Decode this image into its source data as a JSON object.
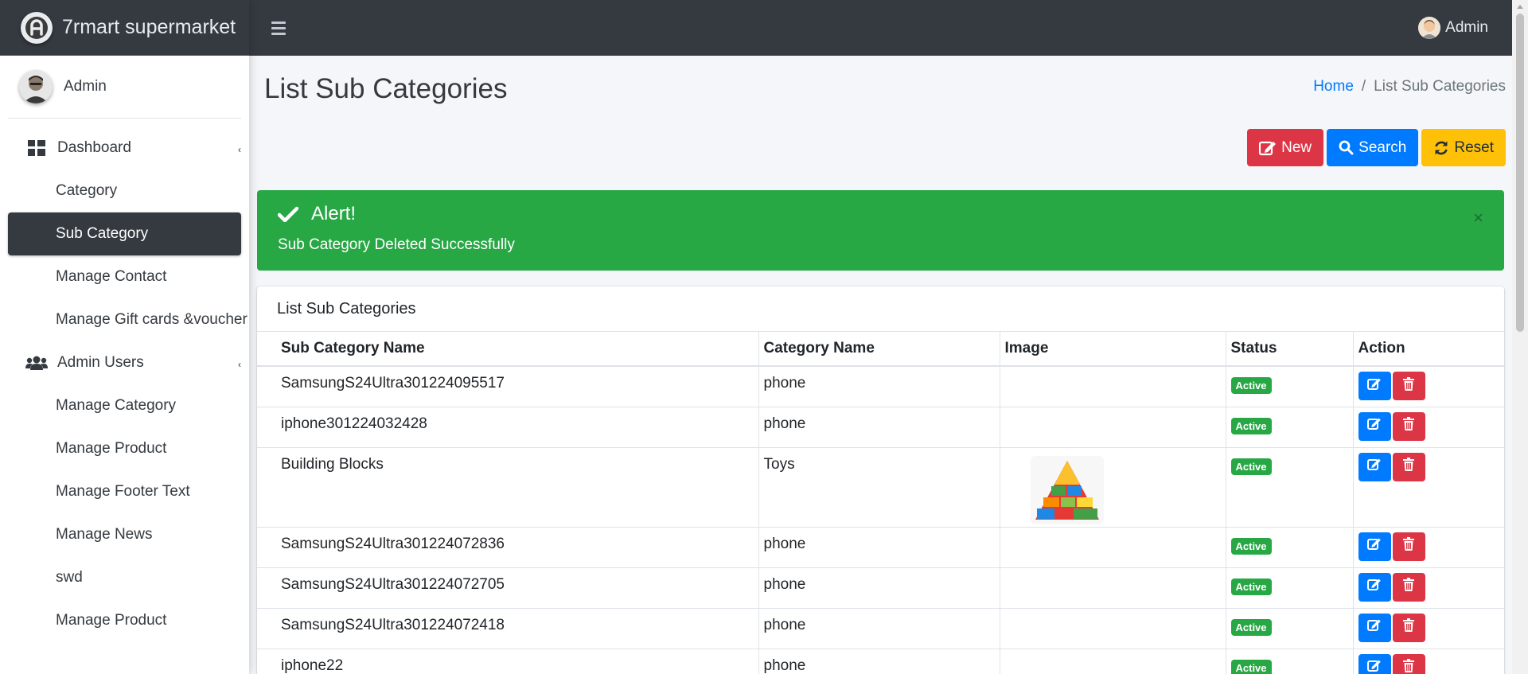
{
  "brand": {
    "name": "7rmart supermarket"
  },
  "topbar": {
    "user": "Admin"
  },
  "sidebar": {
    "user": "Admin",
    "items": [
      {
        "label": "Dashboard",
        "icon": "dashboard-icon",
        "type": "parent"
      },
      {
        "label": "Category",
        "type": "sub"
      },
      {
        "label": "Sub Category",
        "type": "sub",
        "active": true
      },
      {
        "label": "Manage Contact",
        "type": "sub"
      },
      {
        "label": "Manage Gift cards &voucher",
        "type": "sub"
      },
      {
        "label": "Admin Users",
        "icon": "users-icon",
        "type": "parent"
      },
      {
        "label": "Manage Category",
        "type": "sub"
      },
      {
        "label": "Manage Product",
        "type": "sub"
      },
      {
        "label": "Manage Footer Text",
        "type": "sub"
      },
      {
        "label": "Manage News",
        "type": "sub"
      },
      {
        "label": "swd",
        "type": "sub"
      },
      {
        "label": "Manage Product",
        "type": "sub"
      }
    ]
  },
  "page": {
    "title": "List Sub Categories",
    "breadcrumb": {
      "home": "Home",
      "separator": "/",
      "current": "List Sub Categories"
    }
  },
  "buttons": {
    "new": "New",
    "search": "Search",
    "reset": "Reset"
  },
  "alert": {
    "title": "Alert!",
    "message": "Sub Category Deleted Successfully",
    "close": "×"
  },
  "card": {
    "title": "List Sub Categories"
  },
  "table": {
    "headers": {
      "name": "Sub Category Name",
      "category": "Category Name",
      "image": "Image",
      "status": "Status",
      "action": "Action"
    },
    "rows": [
      {
        "name": "SamsungS24Ultra301224095517",
        "category": "phone",
        "status": "Active"
      },
      {
        "name": "iphone301224032428",
        "category": "phone",
        "status": "Active"
      },
      {
        "name": "Building Blocks",
        "category": "Toys",
        "status": "Active",
        "image": "building-blocks-image"
      },
      {
        "name": "SamsungS24Ultra301224072836",
        "category": "phone",
        "status": "Active"
      },
      {
        "name": "SamsungS24Ultra301224072705",
        "category": "phone",
        "status": "Active"
      },
      {
        "name": "SamsungS24Ultra301224072418",
        "category": "phone",
        "status": "Active"
      },
      {
        "name": "iphone22",
        "category": "phone",
        "status": "Active"
      }
    ]
  },
  "colors": {
    "primary": "#007bff",
    "danger": "#dc3545",
    "warning": "#ffc107",
    "success": "#28a745",
    "dark": "#343a40"
  }
}
